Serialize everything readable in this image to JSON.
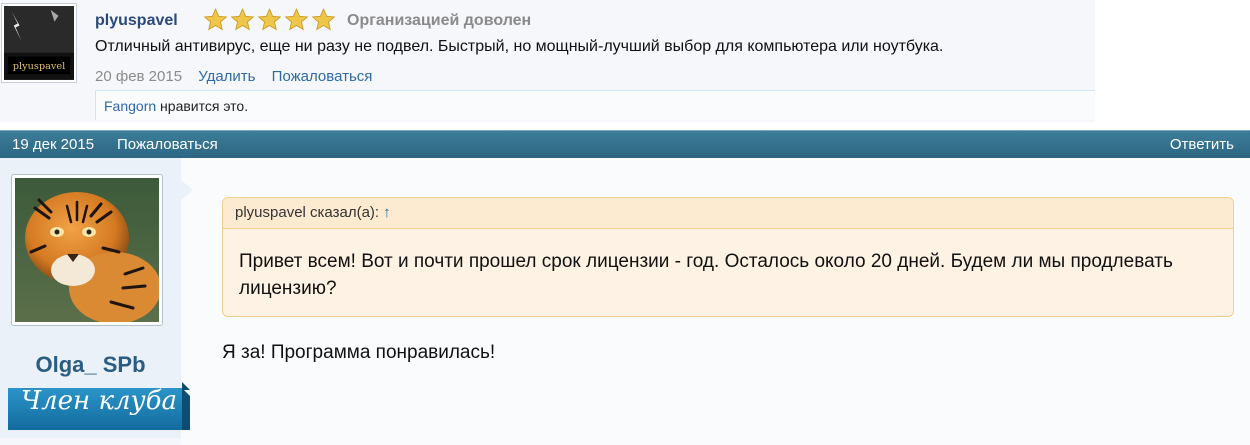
{
  "top_post": {
    "username": "plyuspavel",
    "avatar_caption": "plyuspavel",
    "stars": 5,
    "rating_label": "Организацией доволен",
    "message": "Отличный антивирус, еще ни разу не подвел. Быстрый, но мощный-лучший выбор для компьютера или ноутбука.",
    "date": "20 фев 2015",
    "delete_label": "Удалить",
    "report_label": "Пожаловаться",
    "likes": {
      "user": "Fangorn",
      "text": " нравится это."
    }
  },
  "post_bar": {
    "date": "19 дек 2015",
    "report_label": "Пожаловаться",
    "reply_label": "Ответить"
  },
  "author": {
    "name": "Olga_ SPb",
    "badge": "Член клуба"
  },
  "quote": {
    "author": "plyuspavel сказал(а):",
    "arrow": "↑",
    "text": "Привет всем! Вот и почти прошел срок лицензии - год. Осталось около 20 дней. Будем ли мы продлевать лицензию?"
  },
  "reply": {
    "text": "Я за! Программа понравилась!"
  },
  "colors": {
    "bar": "#2c6682",
    "link": "#2f6aa5",
    "quote_bg": "#fdf2e3",
    "quote_border": "#f3cf8c",
    "star": "#f0c64a"
  }
}
